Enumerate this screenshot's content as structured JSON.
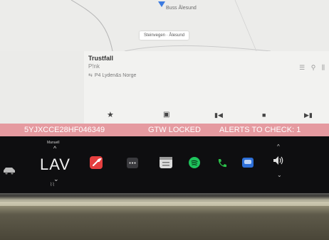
{
  "map": {
    "place_label": "Buss Ålesund",
    "road_chip": "Steinvegen · Ålesund"
  },
  "media": {
    "station_title": "Trustfall",
    "station_artist": "P!nk",
    "station_source": "P4 Lyden&s Norge",
    "icons": [
      "equalizer-icon",
      "search-icon",
      "library-icon"
    ],
    "controls": [
      "favorite-icon",
      "radio-icon",
      "previous-icon",
      "stop-icon",
      "next-icon"
    ]
  },
  "alert_bar": {
    "vin": "5YJXCCE28HF046349",
    "gtw_status": "GTW LOCKED",
    "alerts": "ALERTS TO CHECK: 1"
  },
  "dock": {
    "gear_label": "Manuell",
    "fan_value": "LAV",
    "apps": [
      "service-icon",
      "more-apps-icon",
      "calendar-icon",
      "spotify-icon",
      "phone-icon",
      "messages-icon"
    ]
  },
  "colors": {
    "alert_bar": "#e59aa0",
    "dock_background": "#0e0e10",
    "service_app": "#e53f3f",
    "spotify_app": "#1ec45c",
    "phone_app": "#2cc14a",
    "messages_app": "#2d6fd8",
    "map_pin": "#3c7be0"
  }
}
